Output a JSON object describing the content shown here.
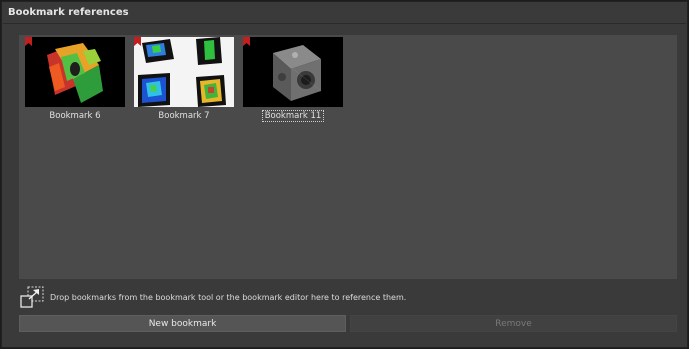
{
  "panel": {
    "title": "Bookmark references"
  },
  "bookmarks": [
    {
      "label": "Bookmark 6",
      "selected": false
    },
    {
      "label": "Bookmark 7",
      "selected": false
    },
    {
      "label": "Bookmark 11",
      "selected": true
    }
  ],
  "hint": {
    "icon": "drop-reference-icon",
    "text": "Drop bookmarks from the bookmark tool or the bookmark editor here to reference them."
  },
  "buttons": {
    "new_label": "New bookmark",
    "remove_label": "Remove"
  },
  "colors": {
    "flag": "#c41e1e",
    "panel_bg": "#3a3a3a",
    "drop_area_bg": "#4a4a4a"
  }
}
